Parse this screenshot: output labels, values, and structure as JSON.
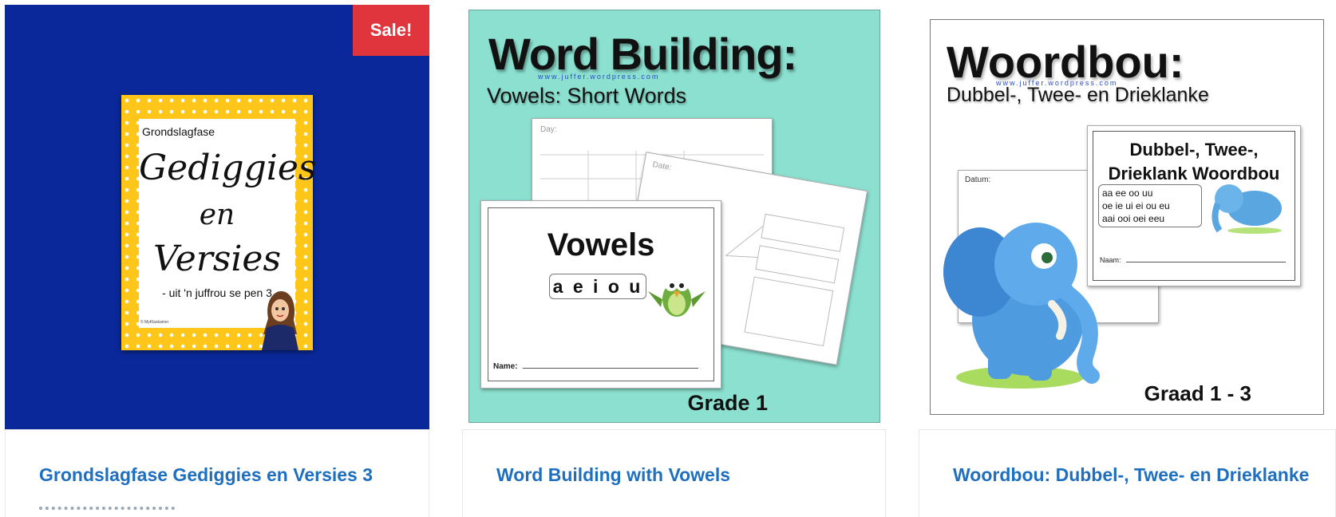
{
  "products": [
    {
      "title": "Grondslagfase Gediggies en Versies 3",
      "badge": "Sale!",
      "cover": {
        "top_label": "Grondslagfase",
        "line1": "Gediggies",
        "line2": "en",
        "line3": "Versies",
        "subtitle": "- uit 'n juffrou se pen 3",
        "footer": "© MyKlaskamer"
      },
      "colors": {
        "background": "#0a2899",
        "frame": "#ffc61a",
        "badge": "#e1353d"
      }
    },
    {
      "title": "Word Building with Vowels",
      "cover": {
        "title": "Word Building:",
        "url": "www.juffer.wordpress.com",
        "subtitle": "Vowels: Short Words",
        "sheet_heading": "Vowels",
        "vowels": "a e i o u",
        "name_label": "Name:",
        "grade": "Grade 1",
        "day_label": "Day:",
        "date_label": "Date:"
      },
      "colors": {
        "background": "#8be0d0"
      }
    },
    {
      "title": "Woordbou: Dubbel-, Twee- en Drieklanke",
      "cover": {
        "title": "Woordbou:",
        "url": "www.juffer.wordpress.com",
        "subtitle": "Dubbel-, Twee- en Drieklanke",
        "sheet_heading_1": "Dubbel-, Twee-,",
        "sheet_heading_2": "Drieklank Woordbou",
        "letters_1": "aa ee oo uu",
        "letters_2": "oe ie ui ei ou eu",
        "letters_3": "aai ooi oei eeu",
        "name_label": "Naam:",
        "date_label": "Datum:",
        "grade": "Graad 1 - 3"
      }
    }
  ],
  "colors": {
    "link": "#1f6fc0"
  }
}
